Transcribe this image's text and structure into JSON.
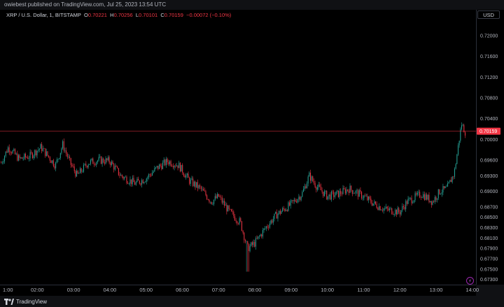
{
  "publisher_line": "owiebest published on TradingView.com, Jul 25, 2023 13:54 UTC",
  "currency_button": "USD",
  "legend": {
    "symbol": "XRP / U.S. Dollar, 1, BITSTAMP",
    "open_label": "O",
    "open_value": "0.70221",
    "high_label": "H",
    "high_value": "0.70256",
    "low_label": "L",
    "low_value": "0.70101",
    "close_label": "C",
    "close_value": "0.70159",
    "change": "−0.00072 (−0.10%)"
  },
  "brand": "TradingView",
  "colors": {
    "up": "#26a69a",
    "down": "#f23645",
    "price_line": "#f23645",
    "background": "#000000"
  },
  "chart_data": {
    "type": "candlestick",
    "symbol": "XRP / U.S. Dollar",
    "interval": "1",
    "exchange": "BITSTAMP",
    "current_price_label": "0.70159",
    "ylim": [
      0.672,
      0.725
    ],
    "y_ticks": [
      "0.72000",
      "0.71600",
      "0.71200",
      "0.70800",
      "0.70400",
      "0.70000",
      "0.69600",
      "0.69300",
      "0.69000",
      "0.68700",
      "0.68500",
      "0.68300",
      "0.68100",
      "0.67900",
      "0.67700",
      "0.67500",
      "0.67300"
    ],
    "x_ticks": [
      "1:00",
      "02:00",
      "03:00",
      "04:00",
      "05:00",
      "06:00",
      "07:00",
      "08:00",
      "09:00",
      "10:00",
      "11:00",
      "12:00",
      "13:00",
      "14:00"
    ],
    "x_range_hours": [
      0.97,
      14.1
    ],
    "path_hourly": [
      [
        1.0,
        0.6955
      ],
      [
        1.2,
        0.6985
      ],
      [
        1.5,
        0.6962
      ],
      [
        1.8,
        0.6968
      ],
      [
        2.1,
        0.6985
      ],
      [
        2.5,
        0.695
      ],
      [
        2.7,
        0.699
      ],
      [
        2.9,
        0.6955
      ],
      [
        3.1,
        0.693
      ],
      [
        3.4,
        0.6955
      ],
      [
        3.7,
        0.696
      ],
      [
        4.0,
        0.6958
      ],
      [
        4.3,
        0.693
      ],
      [
        4.7,
        0.6915
      ],
      [
        5.0,
        0.6925
      ],
      [
        5.3,
        0.6945
      ],
      [
        5.6,
        0.6958
      ],
      [
        5.9,
        0.695
      ],
      [
        6.2,
        0.692
      ],
      [
        6.5,
        0.6905
      ],
      [
        6.8,
        0.688
      ],
      [
        7.0,
        0.689
      ],
      [
        7.3,
        0.686
      ],
      [
        7.6,
        0.684
      ],
      [
        7.8,
        0.679
      ],
      [
        8.0,
        0.68
      ],
      [
        8.3,
        0.683
      ],
      [
        8.6,
        0.6855
      ],
      [
        9.0,
        0.6875
      ],
      [
        9.3,
        0.6895
      ],
      [
        9.5,
        0.693
      ],
      [
        9.7,
        0.691
      ],
      [
        10.0,
        0.689
      ],
      [
        10.3,
        0.6895
      ],
      [
        10.6,
        0.6905
      ],
      [
        11.0,
        0.689
      ],
      [
        11.3,
        0.6875
      ],
      [
        11.6,
        0.6865
      ],
      [
        12.0,
        0.686
      ],
      [
        12.2,
        0.688
      ],
      [
        12.6,
        0.6895
      ],
      [
        12.9,
        0.688
      ],
      [
        13.1,
        0.69
      ],
      [
        13.3,
        0.6905
      ],
      [
        13.5,
        0.6935
      ],
      [
        13.7,
        0.703
      ],
      [
        13.8,
        0.7015
      ]
    ],
    "grid": false,
    "legend_position": "top-left"
  }
}
